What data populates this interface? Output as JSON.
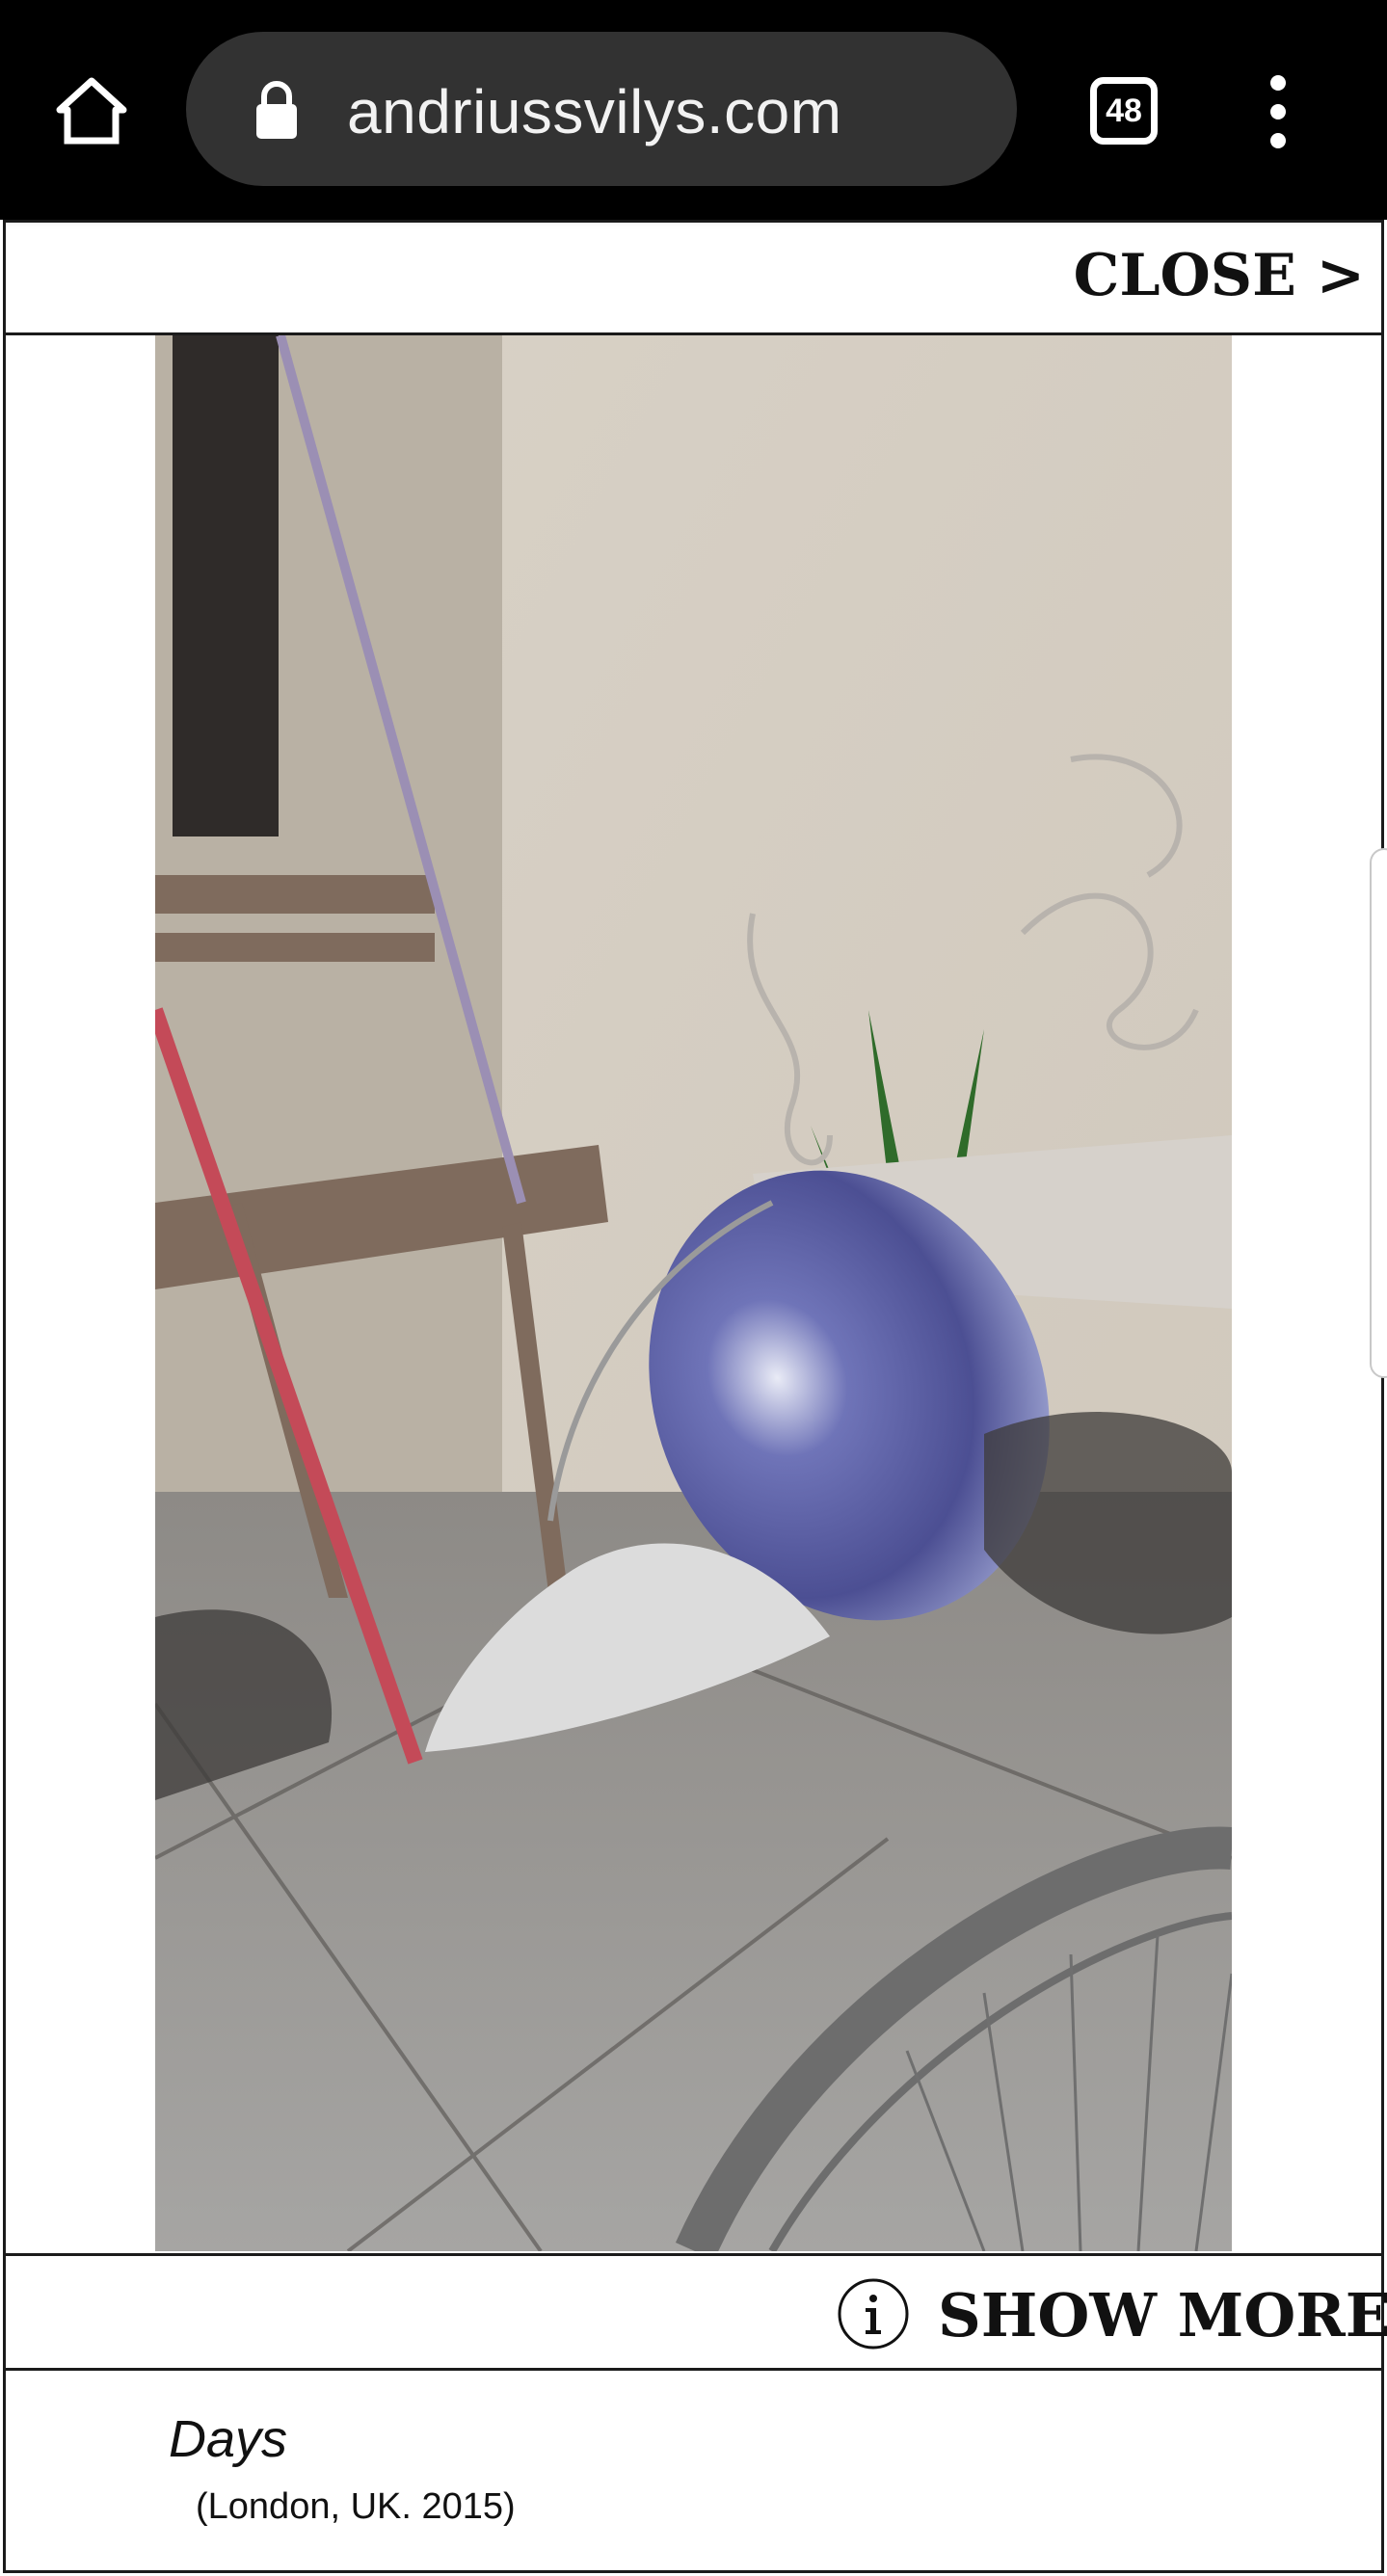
{
  "browser": {
    "url": "andriussvilys.com",
    "tab_count": "48",
    "icons": {
      "home": "home-icon",
      "lock": "lock-icon",
      "menu": "more-vert-icon"
    }
  },
  "lightbox": {
    "close_label": "CLOSE >",
    "show_more_label": "SHOW MORE",
    "info_icon": "info-icon",
    "caption": {
      "title": "Days",
      "subtitle": "(London, UK. 2015)"
    }
  },
  "colors": {
    "toolbar": "#000000",
    "urlbar": "#323232",
    "border": "#1b1b1b"
  }
}
